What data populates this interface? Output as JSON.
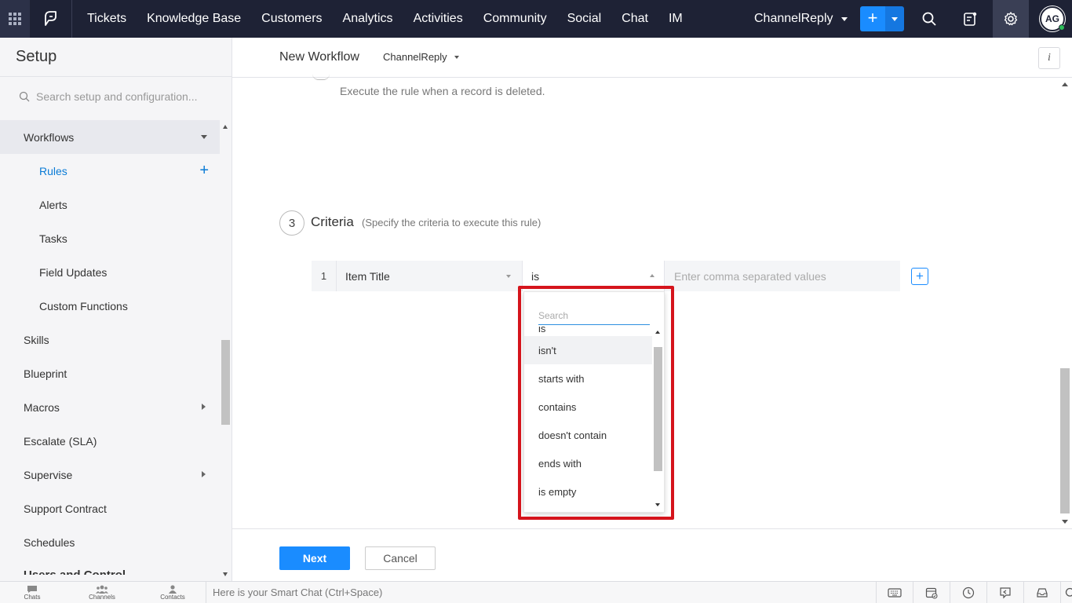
{
  "topnav": {
    "items": [
      "Tickets",
      "Knowledge Base",
      "Customers",
      "Analytics",
      "Activities",
      "Community",
      "Social",
      "Chat",
      "IM"
    ],
    "department": "ChannelReply",
    "avatar_initials": "AG",
    "icons": [
      "apps-grid-icon",
      "logo-icon",
      "plus-icon",
      "search-icon",
      "notepad-icon",
      "gear-icon"
    ]
  },
  "sidebar": {
    "title": "Setup",
    "search_placeholder": "Search setup and configuration...",
    "items": [
      {
        "label": "Workflows"
      },
      {
        "label": "Rules"
      },
      {
        "label": "Alerts"
      },
      {
        "label": "Tasks"
      },
      {
        "label": "Field Updates"
      },
      {
        "label": "Custom Functions"
      },
      {
        "label": "Skills"
      },
      {
        "label": "Blueprint"
      },
      {
        "label": "Macros"
      },
      {
        "label": "Escalate (SLA)"
      },
      {
        "label": "Supervise"
      },
      {
        "label": "Support Contract"
      },
      {
        "label": "Schedules"
      },
      {
        "label": "Users and Control"
      }
    ]
  },
  "main": {
    "title": "New Workflow",
    "department": "ChannelReply",
    "info_label": "i",
    "rule_desc": "Execute the rule when a record is deleted.",
    "criteria": {
      "step": "3",
      "title": "Criteria",
      "hint": "(Specify the criteria to execute this rule)",
      "row_index": "1",
      "field": "Item Title",
      "operator": "is",
      "value_placeholder": "Enter comma separated values",
      "add_label": "+"
    },
    "dropdown": {
      "search_placeholder": "Search",
      "options": [
        "is",
        "isn't",
        "starts with",
        "contains",
        "doesn't contain",
        "ends with",
        "is empty"
      ]
    },
    "buttons": {
      "next": "Next",
      "cancel": "Cancel"
    }
  },
  "bottombar": {
    "tabs": [
      "Chats",
      "Channels",
      "Contacts"
    ],
    "smart_chat": "Here is your Smart Chat (Ctrl+Space)"
  },
  "colors": {
    "nav_bg": "#1e2235",
    "accent": "#1a8cff",
    "highlight": "#d5141c",
    "active_link": "#0a7bd6"
  }
}
